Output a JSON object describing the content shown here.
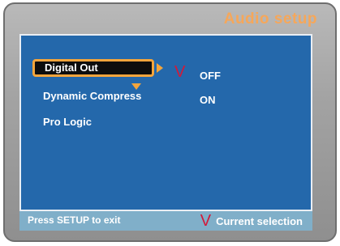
{
  "header": {
    "title": "Audio setup"
  },
  "menu": {
    "items": [
      {
        "label": "Digital Out",
        "selected": true
      },
      {
        "label": "Dynamic Compress",
        "selected": false
      },
      {
        "label": "Pro Logic",
        "selected": false
      }
    ]
  },
  "options": {
    "current_mark": "V",
    "items": [
      {
        "label": "OFF",
        "current": true
      },
      {
        "label": "ON",
        "current": false
      }
    ]
  },
  "status_bar": {
    "hint": "Press SETUP to exit",
    "legend_mark": "V",
    "legend_text": "Current selection"
  },
  "colors": {
    "panel": "#2468ab",
    "highlight": "#f4a53c",
    "title": "#f6a75a",
    "current_mark": "#d21a3a",
    "status_bar": "#80afc9"
  }
}
